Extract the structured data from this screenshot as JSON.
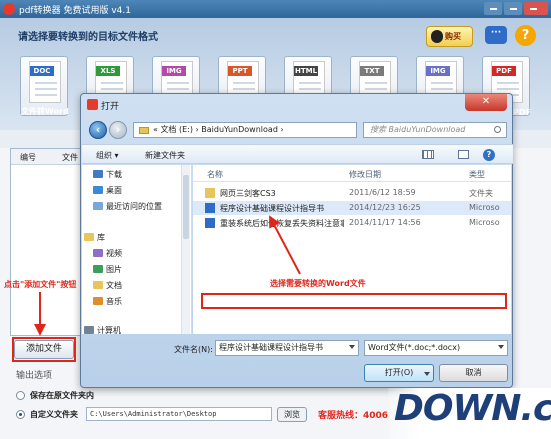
{
  "app": {
    "title": "pdf转换器 免费试用版 v4.1",
    "prompt": "请选择要转换到的目标文件格式",
    "qq_label": "购买",
    "chat_label": "···",
    "help_label": "?",
    "formats": [
      {
        "tag": "DOC",
        "caption": "文件转Word",
        "color": "#2f6cc7"
      },
      {
        "tag": "XLS",
        "caption": "",
        "color": "#2e9a3a"
      },
      {
        "tag": "IMG",
        "caption": "",
        "color": "#b34aa8"
      },
      {
        "tag": "PPT",
        "caption": "",
        "color": "#d8572a"
      },
      {
        "tag": "HTML",
        "caption": "",
        "color": "#444444"
      },
      {
        "tag": "TXT",
        "caption": "",
        "color": "#7a7a7a"
      },
      {
        "tag": "IMG",
        "caption": "",
        "color": "#6a6fc7"
      },
      {
        "tag": "PDF",
        "caption": "PDF",
        "color": "#d02a24"
      }
    ],
    "table": {
      "col_no": "编号",
      "col_file": "文件"
    },
    "add_file_label": "添加文件",
    "output_options_label": "输出选项",
    "opt_original_folder": "保存在原文件夹内",
    "opt_custom_folder": "自定义文件夹",
    "output_path": "C:\\Users\\Administrator\\Desktop",
    "browse_label": "浏览",
    "hotline": "客服热线：4006"
  },
  "dialog": {
    "title": "打开",
    "close_label": "✕",
    "address": "« 文档 (E:) › BaiduYunDownload ›",
    "search_placeholder": "搜索 BaiduYunDownload",
    "organize_label": "组织 ▾",
    "new_folder_label": "新建文件夹",
    "help_label": "?",
    "nav_items": [
      "下载",
      "桌面",
      "最近访问的位置",
      "库",
      "视频",
      "图片",
      "文档",
      "音乐",
      "计算机"
    ],
    "columns": {
      "name": "名称",
      "date": "修改日期",
      "type": "类型"
    },
    "files": [
      {
        "name": "网页三剑客CS3",
        "date": "2011/6/12 18:59",
        "type": "文件夹"
      },
      {
        "name": "程序设计基础课程设计指导书",
        "date": "2014/12/23 16:25",
        "type": "Microso"
      },
      {
        "name": "重装系统后如何恢复丢失资料注意事项...",
        "date": "2014/11/17 14:56",
        "type": "Microso"
      }
    ],
    "filename_label": "文件名(N):",
    "filename_value": "程序设计基础课程设计指导书",
    "filter_value": "Word文件(*.doc;*.docx)",
    "open_label": "打开(O)",
    "cancel_label": "取消"
  },
  "annotations": {
    "click_add": "点击\"添加文件\"按钮",
    "select_word": "选择需要转换的Word文件",
    "accent_color": "#e0261b"
  },
  "watermark": {
    "text": "DOWN.cc"
  }
}
